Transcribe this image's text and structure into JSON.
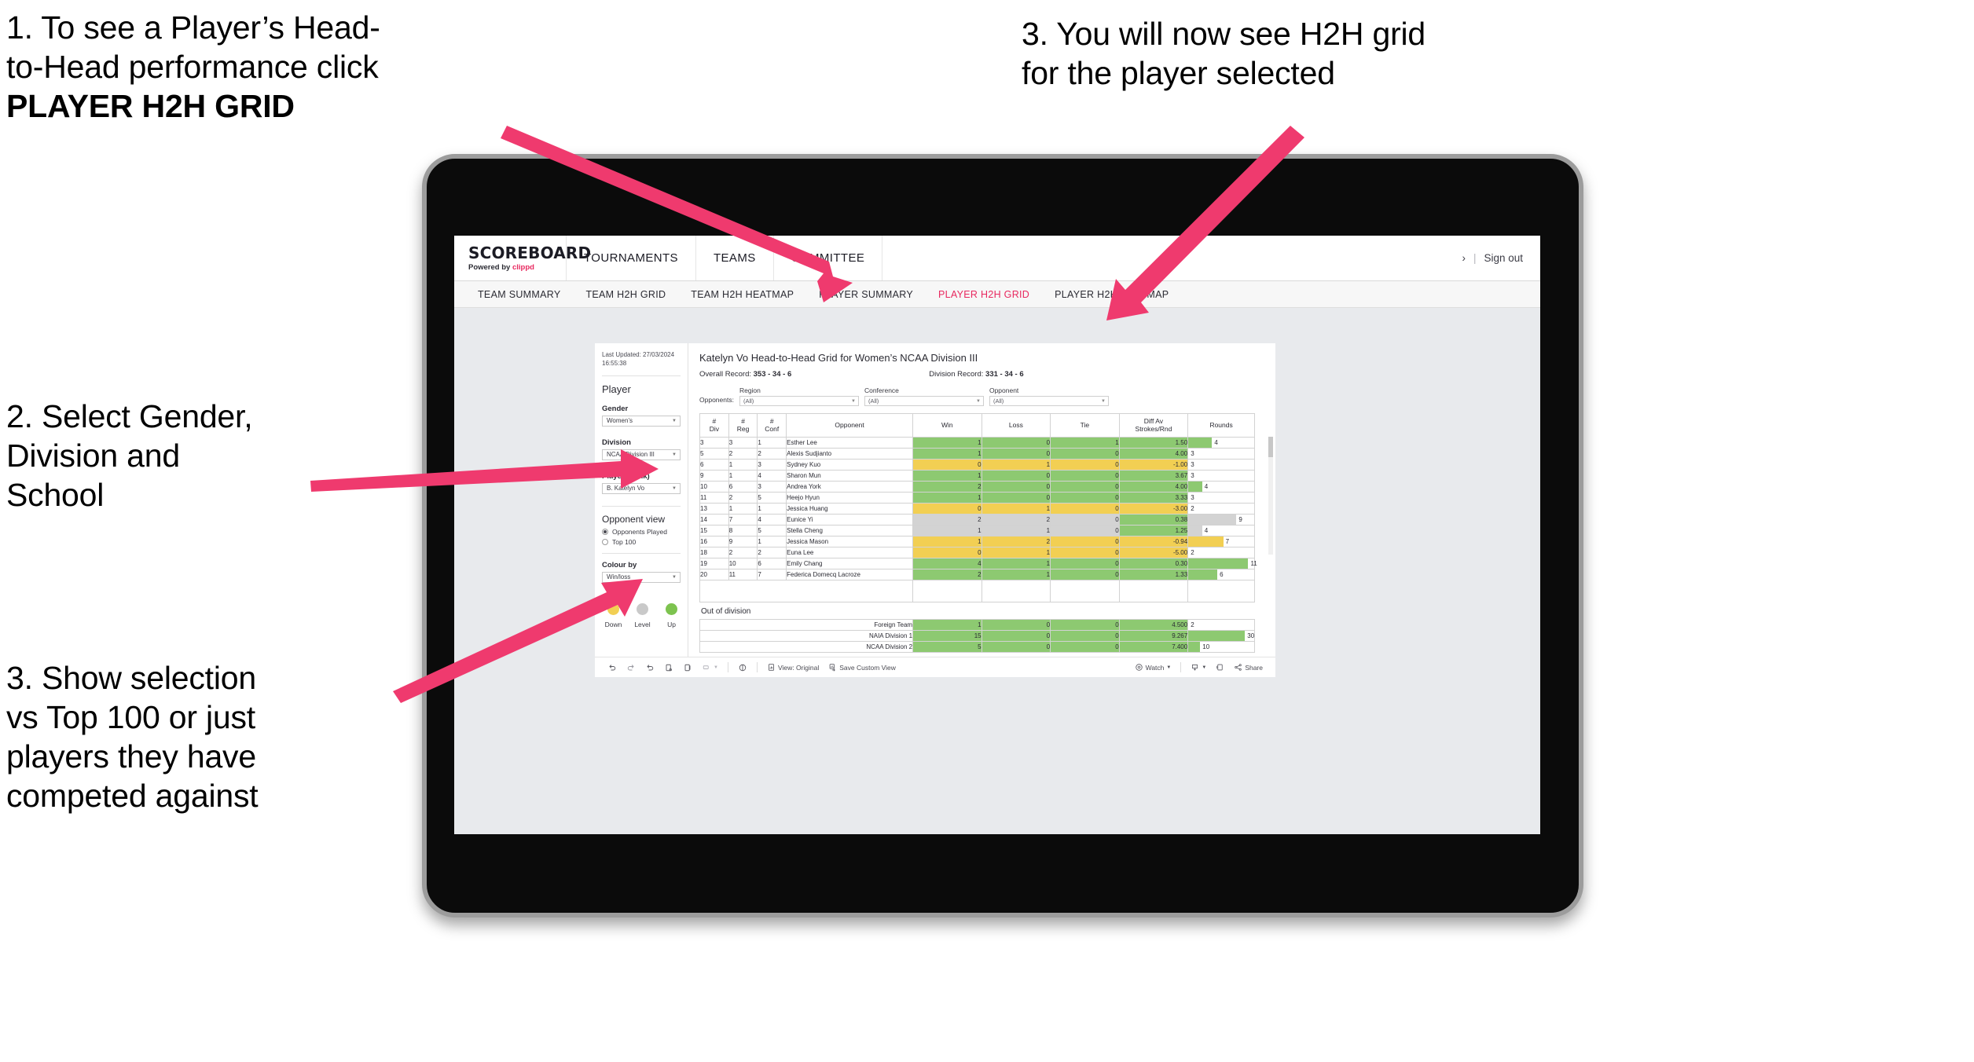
{
  "annotations": [
    {
      "id": "anno1",
      "line1": "1. To see a Player’s Head-",
      "line2": "to-Head performance click",
      "bold": "PLAYER H2H GRID"
    },
    {
      "id": "anno2",
      "text": "2. Select Gender,\nDivision and\nSchool"
    },
    {
      "id": "anno3",
      "text": "3. Show selection\nvs Top 100 or just\nplayers they have\ncompeted against"
    },
    {
      "id": "anno4",
      "text": "3. You will now see H2H grid\nfor the player selected"
    }
  ],
  "accent": "#e8285f",
  "header": {
    "brand_title": "SCOREBOARD",
    "brand_sub_prefix": "Powered by ",
    "brand_sub_brand": "clippd",
    "nav": [
      "TOURNAMENTS",
      "TEAMS",
      "COMMITTEE"
    ],
    "user_chevron": "›",
    "separator": "|",
    "sign_out": "Sign out"
  },
  "subnav": {
    "tabs": [
      "TEAM SUMMARY",
      "TEAM H2H GRID",
      "TEAM H2H HEATMAP",
      "PLAYER SUMMARY",
      "PLAYER H2H GRID",
      "PLAYER H2H HEATMAP"
    ],
    "active": "PLAYER H2H GRID"
  },
  "sidebar": {
    "last_updated_line1": "Last Updated: 27/03/2024",
    "last_updated_line2": "16:55:38",
    "section_player": "Player",
    "gender_label": "Gender",
    "gender_value": "Women’s",
    "division_label": "Division",
    "division_value": "NCAA Division III",
    "player_label": "Player (Rank)",
    "player_value": "B. Katelyn Vo",
    "opponent_view_label": "Opponent view",
    "opponent_view_options": [
      "Opponents Played",
      "Top 100"
    ],
    "opponent_view_selected": "Opponents Played",
    "colour_by_label": "Colour by",
    "colour_by_value": "Win/loss",
    "legend": [
      {
        "label": "Down",
        "color": "#f2cf53"
      },
      {
        "label": "Level",
        "color": "#c9c9c9"
      },
      {
        "label": "Up",
        "color": "#7dc34f"
      }
    ]
  },
  "main": {
    "title": "Katelyn Vo Head-to-Head Grid for Women’s NCAA Division III",
    "overall_record_label": "Overall Record:",
    "overall_record_value": "353 -  34 - 6",
    "division_record_label": "Division Record:",
    "division_record_value": "331 -  34 - 6",
    "opponents_label": "Opponents:",
    "filters": [
      {
        "name": "Region",
        "value": "(All)"
      },
      {
        "name": "Conference",
        "value": "(All)"
      },
      {
        "name": "Opponent",
        "value": "(All)"
      }
    ],
    "out_of_division_title": "Out of division"
  },
  "chart_data": {
    "type": "table",
    "title": "Katelyn Vo Head-to-Head Grid for Women’s NCAA Division III",
    "columns": [
      "# Div",
      "# Reg",
      "# Conf",
      "Opponent",
      "Win",
      "Loss",
      "Tie",
      "Diff Av Strokes/Rnd",
      "Rounds"
    ],
    "column_headers_two_line": [
      {
        "top": "#",
        "bottom": "Div"
      },
      {
        "top": "#",
        "bottom": "Reg"
      },
      {
        "top": "#",
        "bottom": "Conf"
      },
      {
        "top": "Opponent",
        "bottom": ""
      },
      {
        "top": "Win",
        "bottom": ""
      },
      {
        "top": "Loss",
        "bottom": ""
      },
      {
        "top": "Tie",
        "bottom": ""
      },
      {
        "top": "Diff Av",
        "bottom": "Strokes/Rnd"
      },
      {
        "top": "Rounds",
        "bottom": ""
      }
    ],
    "rows": [
      {
        "div": "3",
        "reg": "3",
        "conf": "1",
        "opponent": "Esther Lee",
        "win": "1",
        "loss": "0",
        "tie": "1",
        "diff": "1.50",
        "rounds": "4",
        "color": "green",
        "bar_pct": 36
      },
      {
        "div": "5",
        "reg": "2",
        "conf": "2",
        "opponent": "Alexis Sudjianto",
        "win": "1",
        "loss": "0",
        "tie": "0",
        "diff": "4.00",
        "rounds": "3",
        "color": "green",
        "bar_pct": 0
      },
      {
        "div": "6",
        "reg": "1",
        "conf": "3",
        "opponent": "Sydney Kuo",
        "win": "0",
        "loss": "1",
        "tie": "0",
        "diff": "-1.00",
        "rounds": "3",
        "color": "yellow",
        "bar_pct": 0
      },
      {
        "div": "9",
        "reg": "1",
        "conf": "4",
        "opponent": "Sharon Mun",
        "win": "1",
        "loss": "0",
        "tie": "0",
        "diff": "3.67",
        "rounds": "3",
        "color": "green",
        "bar_pct": 0
      },
      {
        "div": "10",
        "reg": "6",
        "conf": "3",
        "opponent": "Andrea York",
        "win": "2",
        "loss": "0",
        "tie": "0",
        "diff": "4.00",
        "rounds": "4",
        "color": "green",
        "bar_pct": 21
      },
      {
        "div": "11",
        "reg": "2",
        "conf": "5",
        "opponent": "Heejo Hyun",
        "win": "1",
        "loss": "0",
        "tie": "0",
        "diff": "3.33",
        "rounds": "3",
        "color": "green",
        "bar_pct": 0
      },
      {
        "div": "13",
        "reg": "1",
        "conf": "1",
        "opponent": "Jessica Huang",
        "win": "0",
        "loss": "1",
        "tie": "0",
        "diff": "-3.00",
        "rounds": "2",
        "color": "yellow",
        "bar_pct": 0
      },
      {
        "div": "14",
        "reg": "7",
        "conf": "4",
        "opponent": "Eunice Yi",
        "win": "2",
        "loss": "2",
        "tie": "0",
        "diff": "0.38",
        "rounds": "9",
        "color": "grey",
        "bar_pct": 73,
        "diff_color": "green"
      },
      {
        "div": "15",
        "reg": "8",
        "conf": "5",
        "opponent": "Stella Cheng",
        "win": "1",
        "loss": "1",
        "tie": "0",
        "diff": "1.25",
        "rounds": "4",
        "color": "grey",
        "bar_pct": 21,
        "diff_color": "green"
      },
      {
        "div": "16",
        "reg": "9",
        "conf": "1",
        "opponent": "Jessica Mason",
        "win": "1",
        "loss": "2",
        "tie": "0",
        "diff": "-0.94",
        "rounds": "7",
        "color": "yellow",
        "bar_pct": 53
      },
      {
        "div": "18",
        "reg": "2",
        "conf": "2",
        "opponent": "Euna Lee",
        "win": "0",
        "loss": "1",
        "tie": "0",
        "diff": "-5.00",
        "rounds": "2",
        "color": "yellow",
        "bar_pct": 0
      },
      {
        "div": "19",
        "reg": "10",
        "conf": "6",
        "opponent": "Emily Chang",
        "win": "4",
        "loss": "1",
        "tie": "0",
        "diff": "0.30",
        "rounds": "11",
        "color": "green",
        "bar_pct": 91
      },
      {
        "div": "20",
        "reg": "11",
        "conf": "7",
        "opponent": "Federica Domecq Lacroze",
        "win": "2",
        "loss": "1",
        "tie": "0",
        "diff": "1.33",
        "rounds": "6",
        "color": "green",
        "bar_pct": 44
      }
    ],
    "out_of_division": [
      {
        "name": "Foreign Team",
        "win": "1",
        "loss": "0",
        "tie": "0",
        "diff": "4.500",
        "rounds": "2",
        "color": "green",
        "bar_pct": 0
      },
      {
        "name": "NAIA Division 1",
        "win": "15",
        "loss": "0",
        "tie": "0",
        "diff": "9.267",
        "rounds": "30",
        "color": "green",
        "bar_pct": 86
      },
      {
        "name": "NCAA Division 2",
        "win": "5",
        "loss": "0",
        "tie": "0",
        "diff": "7.400",
        "rounds": "10",
        "color": "green",
        "bar_pct": 18
      }
    ]
  },
  "toolbar": {
    "items": [
      {
        "name": "undo",
        "label": ""
      },
      {
        "name": "redo",
        "label": ""
      },
      {
        "name": "revert",
        "label": ""
      },
      {
        "name": "refresh",
        "label": ""
      },
      {
        "name": "pause",
        "label": ""
      },
      {
        "name": "alerts",
        "label": ""
      },
      {
        "name": "view-original",
        "label": "View: Original"
      },
      {
        "name": "save-custom-view",
        "label": "Save Custom View"
      },
      {
        "name": "watch",
        "label": "Watch"
      },
      {
        "name": "download",
        "label": ""
      },
      {
        "name": "fullscreen",
        "label": ""
      },
      {
        "name": "share",
        "label": "Share"
      }
    ],
    "view_original": "View: Original",
    "save_custom_view": "Save Custom View",
    "watch": "Watch",
    "share": "Share"
  }
}
